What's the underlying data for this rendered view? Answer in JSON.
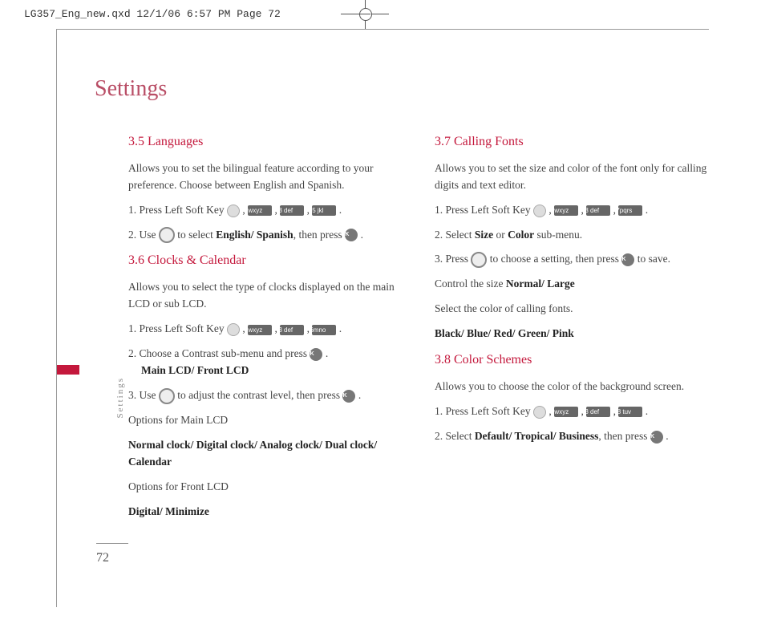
{
  "header": "LG357_Eng_new.qxd  12/1/06  6:57 PM  Page 72",
  "chapter": "Settings",
  "side_label": "Settings",
  "page_number": "72",
  "keys": {
    "k9": "9wxyz",
    "k3": "3 def",
    "k5": "5 jkl",
    "k6": "6mno",
    "k7": "7pqrs",
    "k8": "8 tuv",
    "ok": "OK"
  },
  "left": {
    "s35": {
      "title": "3.5 Languages",
      "intro": "Allows you to set the bilingual feature according to your preference. Choose between English and Spanish.",
      "step1a": "1. Press Left Soft Key ",
      "step2a": "2. Use ",
      "step2b": " to select ",
      "step2c": "English/ Spanish",
      "step2d": ", then press "
    },
    "s36": {
      "title": "3.6 Clocks & Calendar",
      "intro": "Allows you to select the type of clocks displayed on the main LCD or sub LCD.",
      "step1a": "1. Press Left Soft Key ",
      "step2a": "2. Choose a Contrast sub-menu and press ",
      "step2_sub": "Main LCD/ Front LCD",
      "step3a": "3. Use ",
      "step3b": " to adjust the contrast level, then press ",
      "optmain_label": "Options for Main LCD",
      "optmain_values": "Normal clock/ Digital clock/ Analog clock/ Dual clock/ Calendar",
      "optfront_label": "Options for Front LCD",
      "optfront_values": "Digital/ Minimize"
    }
  },
  "right": {
    "s37": {
      "title": "3.7 Calling Fonts",
      "intro": "Allows you to set the size and color of the font only for calling digits and text editor.",
      "step1a": "1. Press Left Soft Key ",
      "step2a": "2. Select ",
      "step2b": "Size",
      "step2c": " or ",
      "step2d": "Color",
      "step2e": " sub-menu.",
      "step3a": "3. Press ",
      "step3b": " to choose a setting, then press ",
      "step3c": " to save.",
      "ctrl_a": "Control the size ",
      "ctrl_b": "Normal/ Large",
      "sel": "Select the color of calling fonts.",
      "colors": "Black/ Blue/ Red/ Green/ Pink"
    },
    "s38": {
      "title": "3.8 Color Schemes",
      "intro": "Allows you to choose the color of the background screen.",
      "step1a": "1. Press Left Soft Key ",
      "step2a": "2. Select ",
      "step2b": "Default/ Tropical/ Business",
      "step2c": ", then press "
    }
  }
}
